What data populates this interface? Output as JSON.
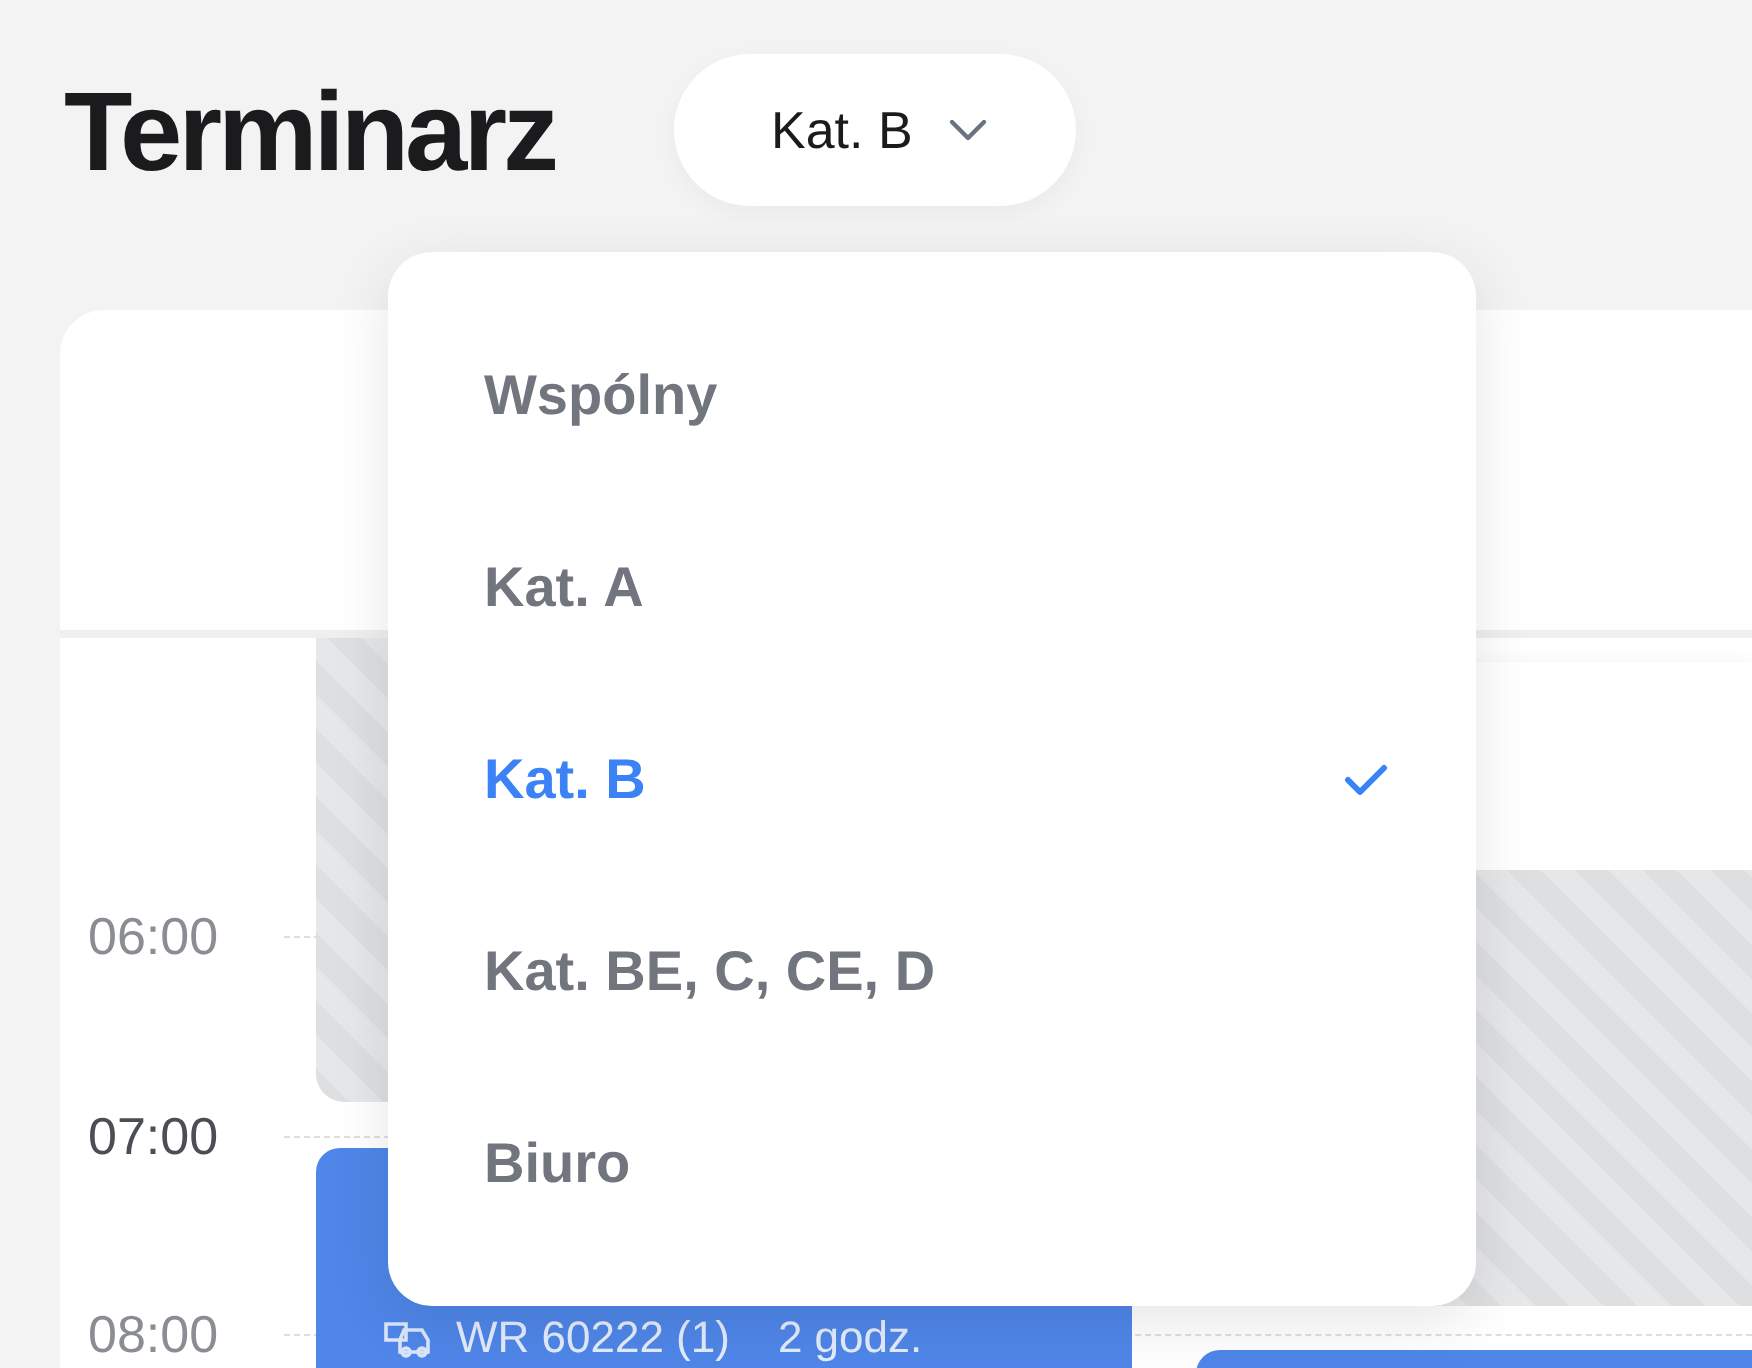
{
  "title": "Terminarz",
  "category_picker": {
    "value": "Kat. B"
  },
  "calendar": {
    "hours": [
      "06:00",
      "07:00",
      "08:00"
    ],
    "events": [
      {
        "kind": "blocked"
      },
      {
        "kind": "lesson",
        "vehicle": "WR 60222 (1)",
        "duration": "2 godz."
      },
      {
        "kind": "card"
      },
      {
        "kind": "blocked"
      },
      {
        "kind": "lesson"
      }
    ]
  },
  "dropdown": {
    "items": [
      {
        "label": "Wspólny",
        "selected": false
      },
      {
        "label": "Kat. A",
        "selected": false
      },
      {
        "label": "Kat. B",
        "selected": true
      },
      {
        "label": "Kat. BE, C, CE, D",
        "selected": false
      },
      {
        "label": "Biuro",
        "selected": false
      }
    ]
  }
}
